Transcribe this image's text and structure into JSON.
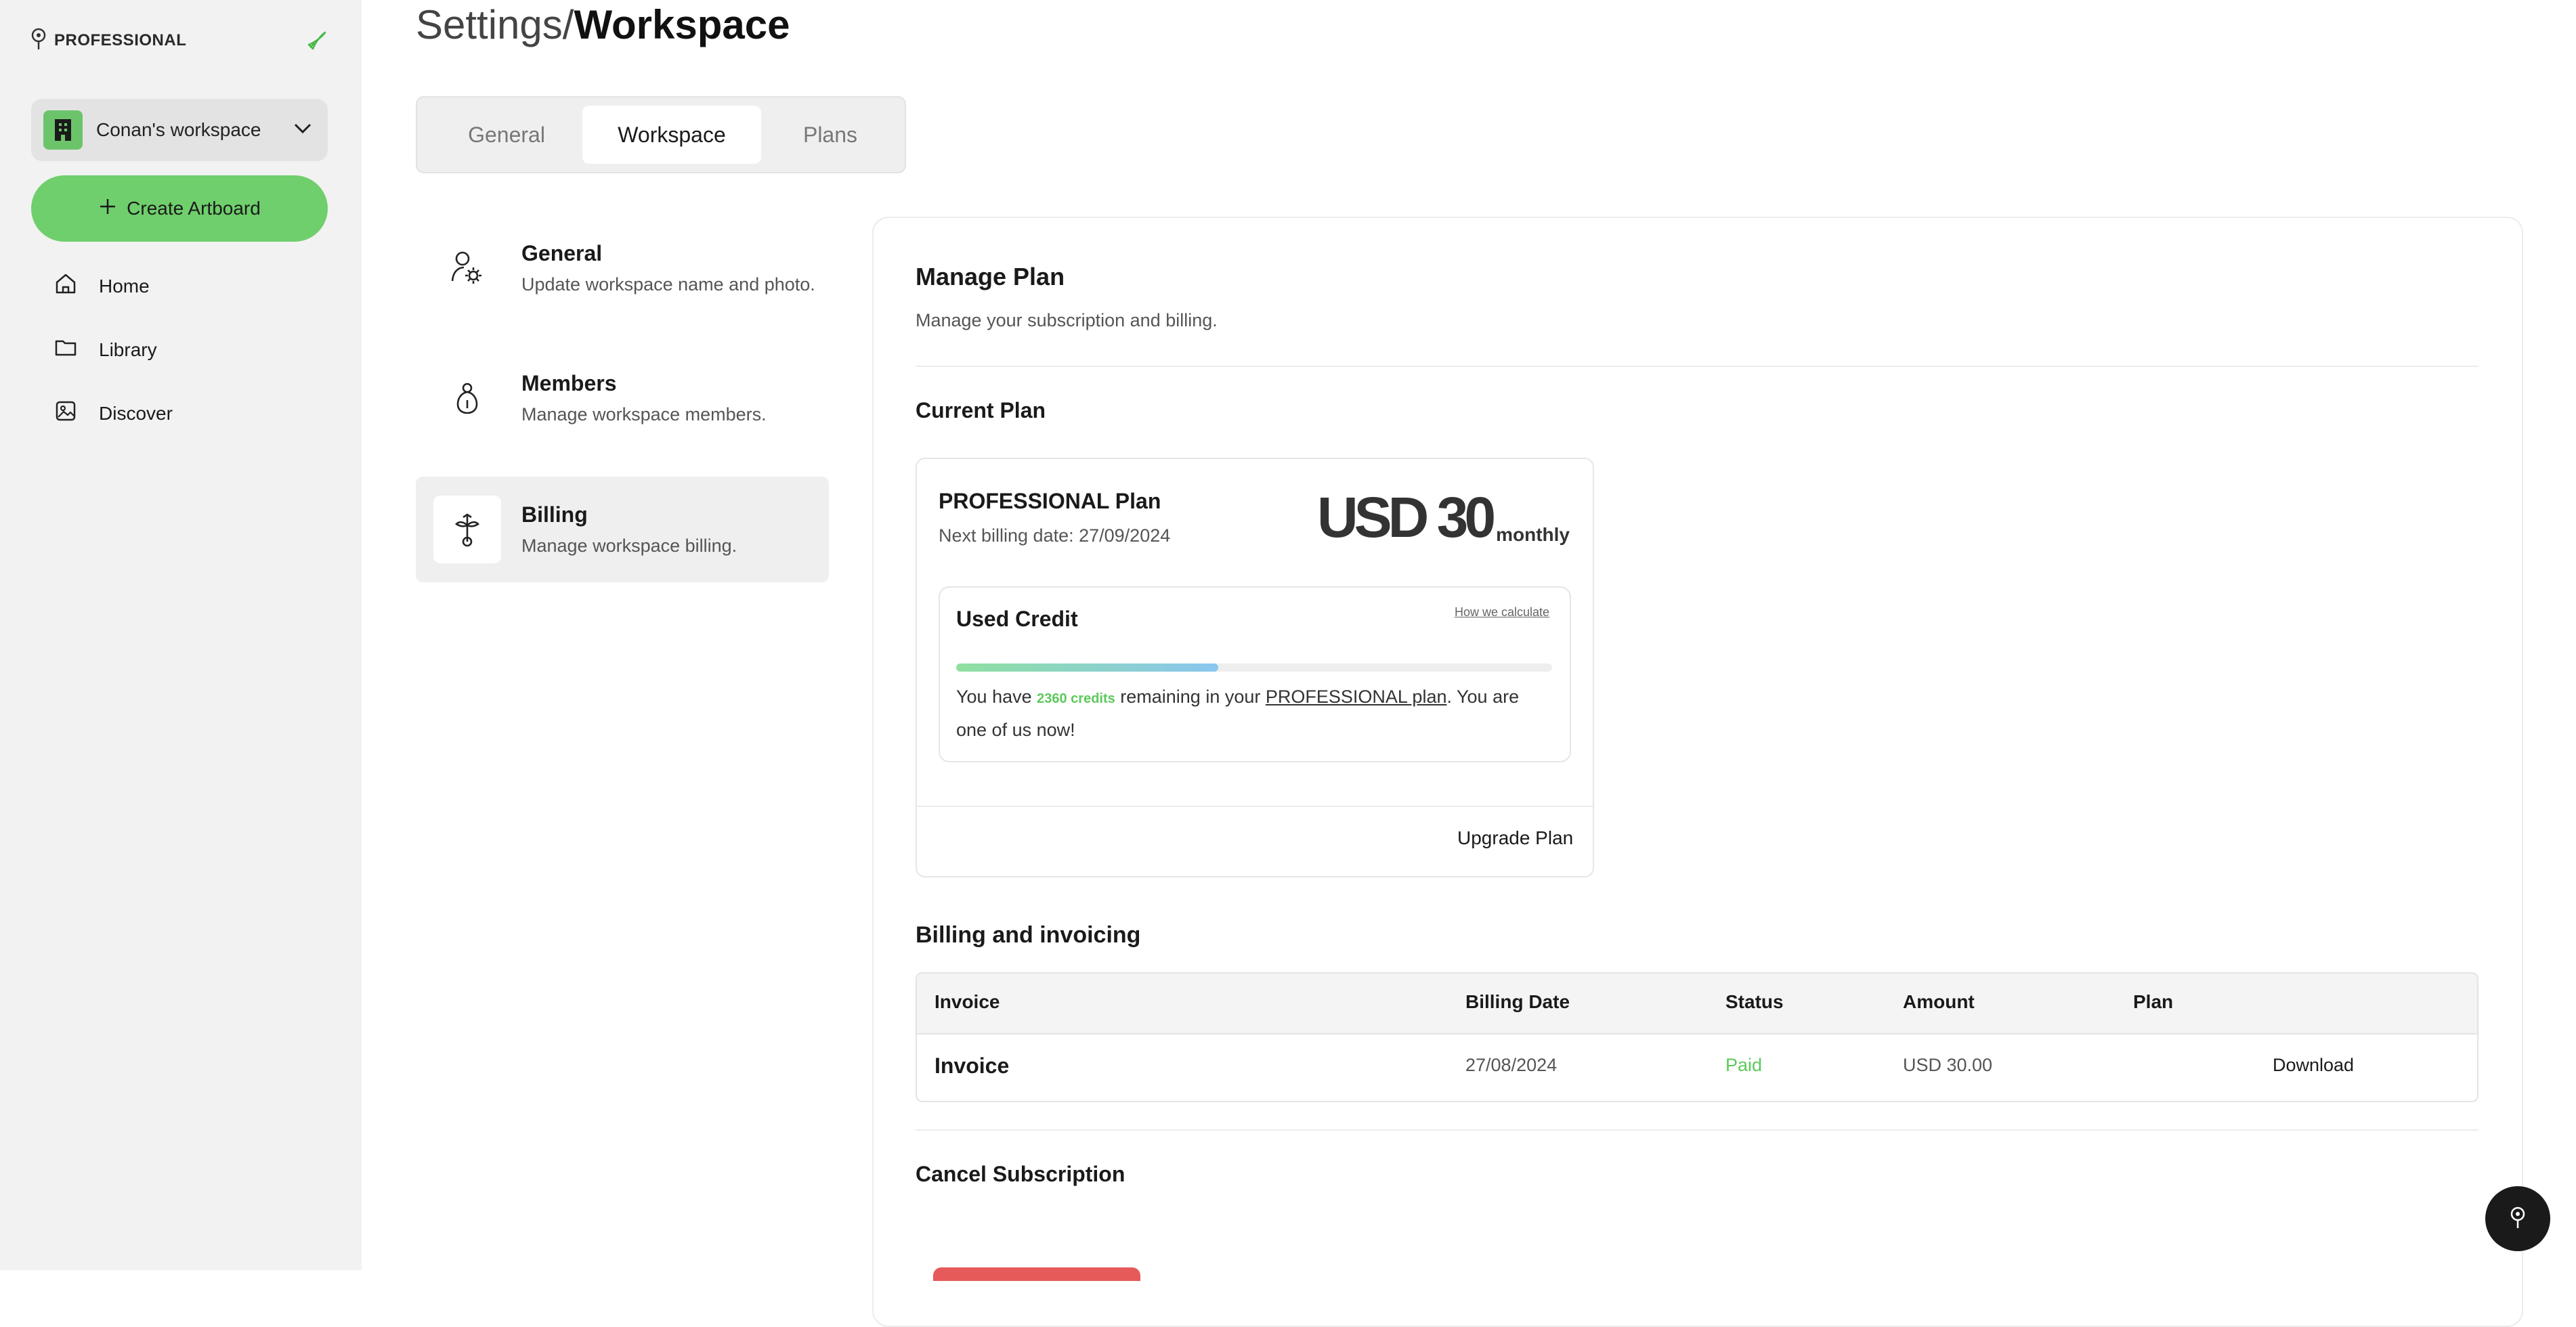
{
  "sidebar": {
    "brand": "PROFESSIONAL",
    "workspace_name": "Conan's workspace",
    "create_label": "Create Artboard",
    "nav": [
      "Home",
      "Library",
      "Discover"
    ]
  },
  "header": {
    "title_prefix": "Settings/",
    "title_main": "Workspace"
  },
  "tabs": [
    "General",
    "Workspace",
    "Plans"
  ],
  "subnav": [
    {
      "title": "General",
      "desc": "Update workspace name and photo."
    },
    {
      "title": "Members",
      "desc": "Manage workspace members."
    },
    {
      "title": "Billing",
      "desc": "Manage workspace billing."
    }
  ],
  "manage": {
    "title": "Manage Plan",
    "subtitle": "Manage your subscription and billing.",
    "current_plan_heading": "Current Plan",
    "plan_name": "PROFESSIONAL Plan",
    "next_billing": "Next billing date: 27/09/2024",
    "price": "USD 30",
    "period": "monthly",
    "used_credit_title": "Used Credit",
    "how_link": "How we calculate",
    "credit_progress": 0.44,
    "credit_text_1": "You have ",
    "credits": "2360 credits",
    "credit_text_2": " remaining in your ",
    "plan_link": "PROFESSIONAL plan",
    "credit_text_3": ". You are one of us now!",
    "upgrade_label": "Upgrade Plan"
  },
  "billing": {
    "heading": "Billing and invoicing",
    "columns": [
      "Invoice",
      "Billing Date",
      "Status",
      "Amount",
      "Plan"
    ],
    "rows": [
      {
        "invoice": "Invoice",
        "date": "27/08/2024",
        "status": "Paid",
        "amount": "USD 30.00",
        "action": "Download"
      }
    ]
  },
  "cancel": {
    "heading": "Cancel Subscription"
  },
  "colors": {
    "accent": "#6fcf6c",
    "paid": "#5cc95a",
    "danger": "#e65a5a"
  }
}
